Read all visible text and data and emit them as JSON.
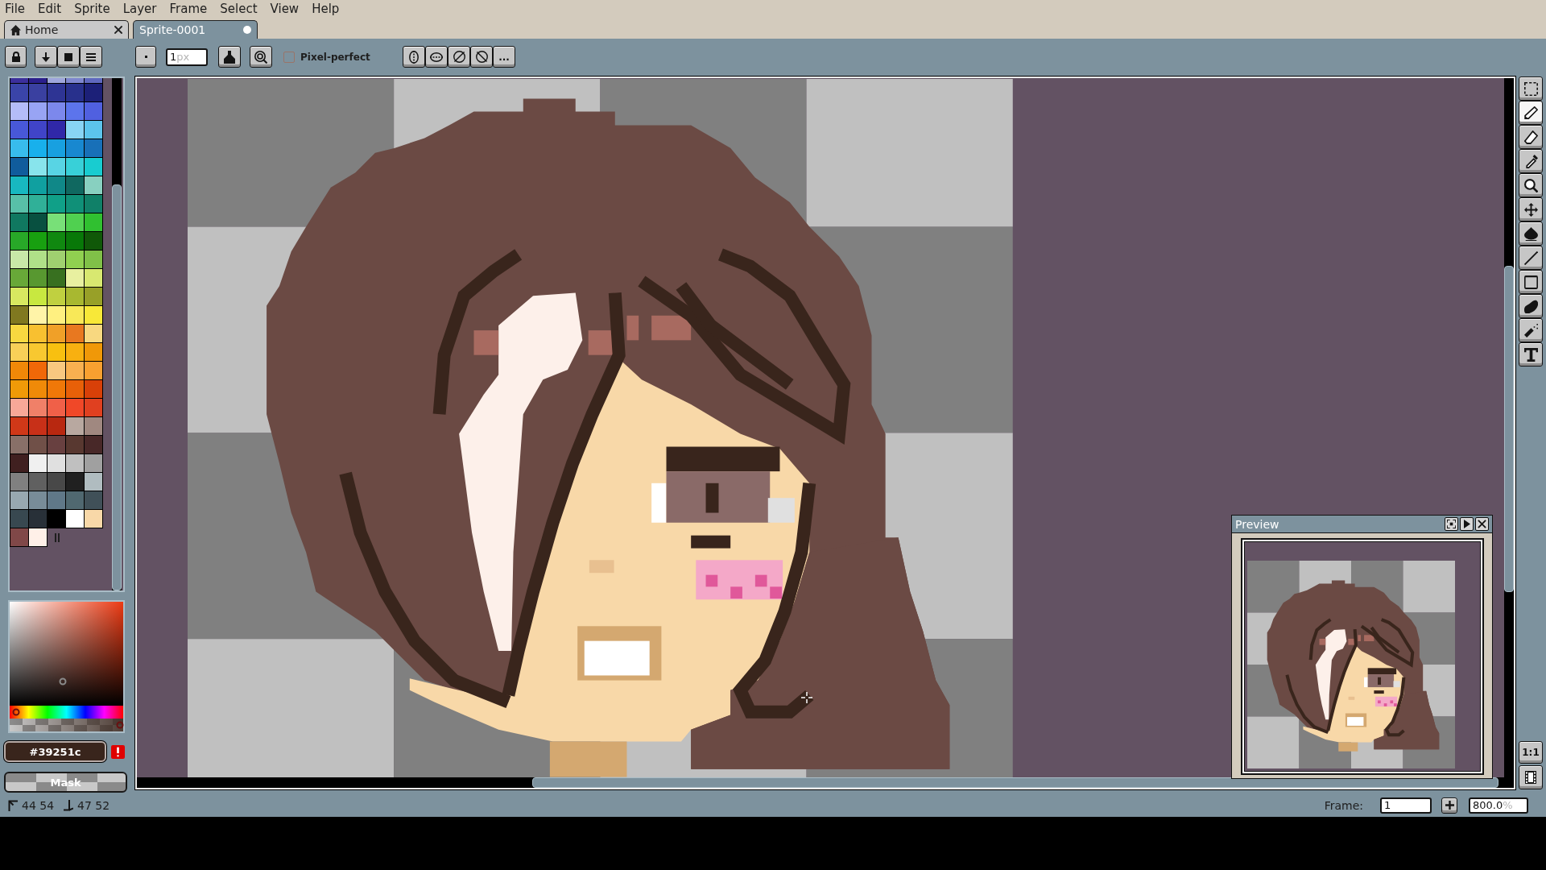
{
  "menu_bar": {
    "items": [
      "File",
      "Edit",
      "Sprite",
      "Layer",
      "Frame",
      "Select",
      "View",
      "Help"
    ]
  },
  "tabs": [
    {
      "label": "Home",
      "kind": "home",
      "selected": false,
      "modified": false
    },
    {
      "label": "Sprite-0001",
      "kind": "sprite",
      "selected": true,
      "modified": true
    }
  ],
  "toolbar": {
    "brush_size": {
      "value": "1",
      "suffix": "px"
    },
    "pixel_perfect": {
      "label": "Pixel-perfect",
      "checked": false
    },
    "more_button": "..."
  },
  "palette": {
    "swatches": [
      {
        "color": "#3c2f9c"
      },
      {
        "color": "#2b1f8c"
      },
      {
        "color": "#9fa6dc"
      },
      {
        "color": "#7f87cf"
      },
      {
        "color": "#5f68bf"
      },
      {
        "color": "#3a44a8"
      },
      {
        "color": "#3a40a0"
      },
      {
        "color": "#2e3494"
      },
      {
        "color": "#28308c"
      },
      {
        "color": "#1c2078"
      },
      {
        "color": "#b4bcf8"
      },
      {
        "color": "#98a4f4"
      },
      {
        "color": "#7c88ec"
      },
      {
        "color": "#5c74ec"
      },
      {
        "color": "#5060e0"
      },
      {
        "color": "#4858d8"
      },
      {
        "color": "#4044c8"
      },
      {
        "color": "#3028a8"
      },
      {
        "color": "#88d4f4"
      },
      {
        "color": "#5cc4ec"
      },
      {
        "color": "#38bcec"
      },
      {
        "color": "#18b0ec"
      },
      {
        "color": "#18a0e0"
      },
      {
        "color": "#1888d0"
      },
      {
        "color": "#1870b8"
      },
      {
        "color": "#105c9c"
      },
      {
        "color": "#88e4ec"
      },
      {
        "color": "#58d4e4"
      },
      {
        "color": "#38d0d8"
      },
      {
        "color": "#18ccd0"
      },
      {
        "color": "#18b8c0"
      },
      {
        "color": "#10a0a0"
      },
      {
        "color": "#108888"
      },
      {
        "color": "#106860"
      },
      {
        "color": "#88d0c0"
      },
      {
        "color": "#58c0a8"
      },
      {
        "color": "#30b098"
      },
      {
        "color": "#10a088"
      },
      {
        "color": "#109078"
      },
      {
        "color": "#108068"
      },
      {
        "color": "#107860"
      },
      {
        "color": "#085040"
      },
      {
        "color": "#78e078"
      },
      {
        "color": "#50d050"
      },
      {
        "color": "#30c030"
      },
      {
        "color": "#28a828"
      },
      {
        "color": "#18a010"
      },
      {
        "color": "#108810"
      },
      {
        "color": "#087808"
      },
      {
        "color": "#105808"
      },
      {
        "color": "#c8e8a8"
      },
      {
        "color": "#b0e088"
      },
      {
        "color": "#a0d070"
      },
      {
        "color": "#90d050"
      },
      {
        "color": "#80c048"
      },
      {
        "color": "#68a838"
      },
      {
        "color": "#589830"
      },
      {
        "color": "#387020"
      },
      {
        "color": "#e8f0a0"
      },
      {
        "color": "#d8e870"
      },
      {
        "color": "#d8e860"
      },
      {
        "color": "#c8e840"
      },
      {
        "color": "#c0d040"
      },
      {
        "color": "#a8b830"
      },
      {
        "color": "#98a028"
      },
      {
        "color": "#807820"
      },
      {
        "color": "#fff4a8"
      },
      {
        "color": "#fff080"
      },
      {
        "color": "#f8e858"
      },
      {
        "color": "#f8e838"
      },
      {
        "color": "#f8d840"
      },
      {
        "color": "#f8c030"
      },
      {
        "color": "#f0a028"
      },
      {
        "color": "#e87820"
      },
      {
        "color": "#f8d880"
      },
      {
        "color": "#f8d058"
      },
      {
        "color": "#f8c830"
      },
      {
        "color": "#f8c010"
      },
      {
        "color": "#f8b010"
      },
      {
        "color": "#f09808"
      },
      {
        "color": "#f08808"
      },
      {
        "color": "#f06808"
      },
      {
        "color": "#f8c880"
      },
      {
        "color": "#f8b050"
      },
      {
        "color": "#f8a030"
      },
      {
        "color": "#f09a08"
      },
      {
        "color": "#f08a08"
      },
      {
        "color": "#f07808"
      },
      {
        "color": "#e86008"
      },
      {
        "color": "#d84008"
      },
      {
        "color": "#f8a898"
      },
      {
        "color": "#f08068"
      },
      {
        "color": "#f06048"
      },
      {
        "color": "#f04828"
      },
      {
        "color": "#e04020"
      },
      {
        "color": "#d03818"
      },
      {
        "color": "#c83018"
      },
      {
        "color": "#b82810"
      },
      {
        "color": "#b8a8a0"
      },
      {
        "color": "#a08880"
      },
      {
        "color": "#887068"
      },
      {
        "color": "#705048"
      },
      {
        "color": "#684040"
      },
      {
        "color": "#583830"
      },
      {
        "color": "#482828"
      },
      {
        "color": "#402020"
      },
      {
        "color": "#f0f0f0"
      },
      {
        "color": "#e0e0e0"
      },
      {
        "color": "#c0c0c0"
      },
      {
        "color": "#a0a0a0"
      },
      {
        "color": "#808080"
      },
      {
        "color": "#606060"
      },
      {
        "color": "#484848"
      },
      {
        "color": "#202020"
      },
      {
        "color": "#b0bcc0"
      },
      {
        "color": "#98a8b0"
      },
      {
        "color": "#788c98"
      },
      {
        "color": "#607888"
      },
      {
        "color": "#506870"
      },
      {
        "color": "#405058"
      },
      {
        "color": "#384850"
      },
      {
        "color": "#283038"
      },
      {
        "color": "#000000"
      },
      {
        "color": "#ffffff"
      },
      {
        "color": "#f8d8a8"
      },
      {
        "color": "#804848"
      },
      {
        "color": "#fff0e8"
      }
    ]
  },
  "color_picker": {
    "saturation": {
      "level": 0.47
    },
    "brightness": {
      "level": 0.23
    },
    "hue": {
      "level": 0.03
    },
    "alpha": {
      "level": 1
    }
  },
  "color_field": {
    "value": "#39251c"
  },
  "mask_button": {
    "label": "Mask"
  },
  "tools": [
    {
      "kind": "marquee",
      "selected": false
    },
    {
      "kind": "pencil",
      "selected": true
    },
    {
      "kind": "eraser",
      "selected": false
    },
    {
      "kind": "eyedropper",
      "selected": false
    },
    {
      "kind": "zoom",
      "selected": false
    },
    {
      "kind": "move",
      "selected": false
    },
    {
      "kind": "fill",
      "selected": false
    },
    {
      "kind": "line",
      "selected": false
    },
    {
      "kind": "rectangle",
      "selected": false
    },
    {
      "kind": "contour",
      "selected": false
    },
    {
      "kind": "spray",
      "selected": false
    },
    {
      "kind": "text",
      "selected": false
    }
  ],
  "zoom_buttons": {
    "actual_size": "1:1"
  },
  "preview": {
    "title": "Preview"
  },
  "status_bar": {
    "readouts": [
      {
        "kind": "position",
        "text": "44 54"
      },
      {
        "kind": "size",
        "text": "47 52"
      }
    ],
    "frame": {
      "label": "Frame:",
      "value": "1"
    },
    "zoom": {
      "value": "800.0",
      "suffix": "%"
    }
  }
}
